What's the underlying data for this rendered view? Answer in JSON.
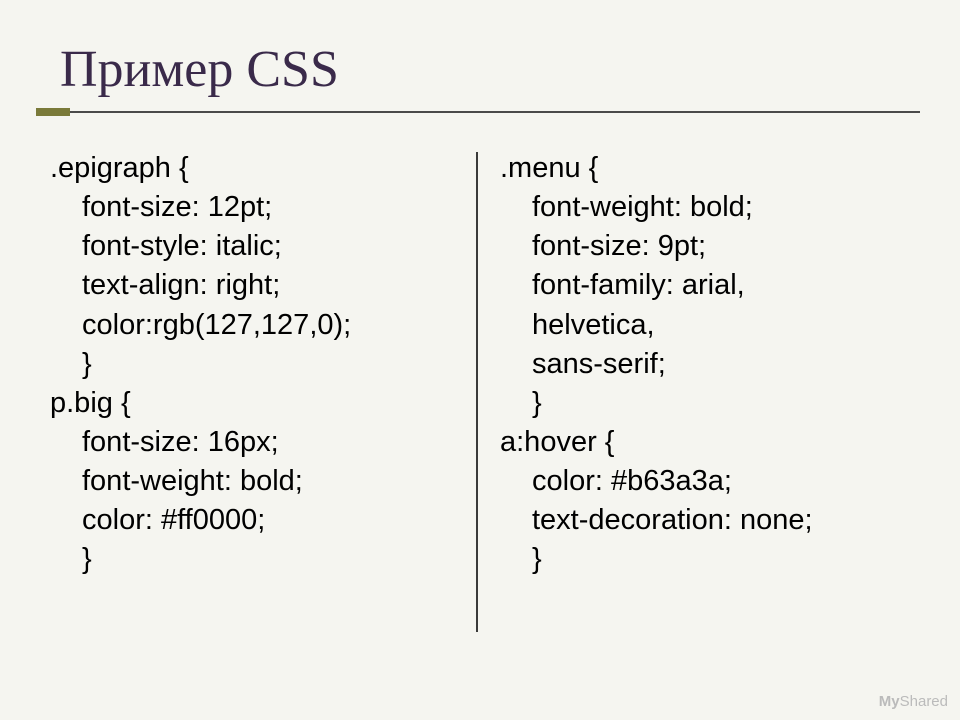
{
  "title": "Пример CSS",
  "left": {
    "l1": ".epigraph {",
    "l2": "font-size: 12pt;",
    "l3": "font-style: italic;",
    "l4": "text-align: right;",
    "l5": "color:rgb(127,127,0);",
    "l6": "}",
    "l7": "p.big {",
    "l8": "font-size: 16px;",
    "l9": "font-weight: bold;",
    "l10": "color: #ff0000;",
    "l11": "}"
  },
  "right": {
    "l1": ".menu {",
    "l2": "font-weight: bold;",
    "l3": "font-size: 9pt;",
    "l4": "font-family: arial,",
    "l5": "helvetica,",
    "l6": "sans-serif;",
    "l7": "}",
    "l8": "a:hover {",
    "l9": "color: #b63a3a;",
    "l10": "text-decoration: none;",
    "l11": "}"
  },
  "watermark": {
    "my": "My",
    "shared": "Shared"
  }
}
